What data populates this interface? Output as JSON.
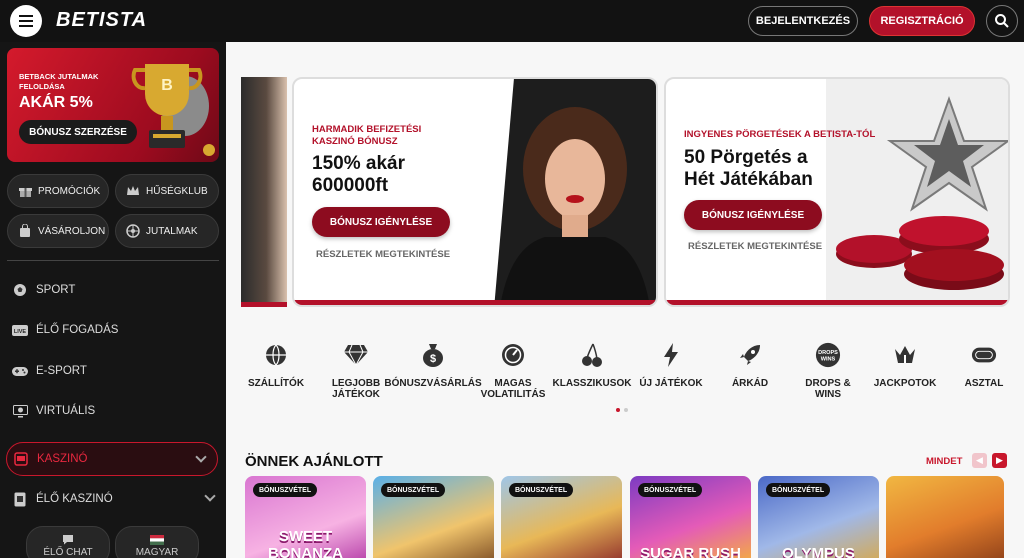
{
  "header": {
    "logo": "BETISTA",
    "login_label": "BEJELENTKEZÉS",
    "register_label": "REGISZTRÁCIÓ"
  },
  "sidebar": {
    "promo": {
      "small_text": "BETBACK JUTALMAK FELOLDÁSA",
      "big_text": "AKÁR 5%",
      "cta": "BÓNUSZ SZERZÉSE"
    },
    "quick_buttons": [
      {
        "label": "PROMÓCIÓK",
        "icon": "gift-icon"
      },
      {
        "label": "HŰSÉGKLUB",
        "icon": "crown-icon"
      },
      {
        "label": "VÁSÁROLJON",
        "icon": "bag-icon"
      },
      {
        "label": "JUTALMAK",
        "icon": "wheel-icon"
      }
    ],
    "nav": [
      {
        "label": "SPORT",
        "icon": "soccer-ball-icon"
      },
      {
        "label": "ÉLŐ FOGADÁS",
        "icon": "live-icon"
      },
      {
        "label": "E-SPORT",
        "icon": "gamepad-icon"
      },
      {
        "label": "VIRTUÁLIS",
        "icon": "virtual-icon"
      },
      {
        "label": "KASZINÓ",
        "icon": "slot-icon"
      },
      {
        "label": "ÉLŐ KASZINÓ",
        "icon": "cards-icon"
      }
    ],
    "bottom": {
      "chat_label": "ÉLŐ CHAT",
      "language_label": "MAGYAR"
    }
  },
  "banners": [
    {
      "pre": "HARMADIK BEFIZETÉSI KASZINÓ BÓNUSZ",
      "title_line1": "150% akár",
      "title_line2": "600000ft",
      "cta": "BÓNUSZ IGÉNYLÉSE",
      "link": "RÉSZLETEK MEGTEKINTÉSE"
    },
    {
      "pre": "INGYENES PÖRGETÉSEK A BETISTA-TÓL",
      "title_line1": "50 Pörgetés a",
      "title_line2": "Hét Játékában",
      "cta": "BÓNUSZ IGÉNYLÉSE",
      "link": "RÉSZLETEK MEGTEKINTÉSE"
    }
  ],
  "categories": [
    {
      "label": "SZÁLLÍTÓK",
      "icon": "globe-icon"
    },
    {
      "label": "LEGJOBB JÁTÉKOK",
      "icon": "diamond-icon"
    },
    {
      "label": "BÓNUSZVÁSÁRLÁS",
      "icon": "money-bag-icon"
    },
    {
      "label": "MAGAS VOLATILITÁS",
      "icon": "gauge-icon"
    },
    {
      "label": "KLASSZIKUSOK",
      "icon": "cherry-icon"
    },
    {
      "label": "ÚJ JÁTÉKOK",
      "icon": "lightning-icon"
    },
    {
      "label": "ÁRKÁD",
      "icon": "rocket-icon"
    },
    {
      "label": "DROPS & WINS",
      "icon": "drops-wins-icon"
    },
    {
      "label": "JACKPOTOK",
      "icon": "jackpot-icon"
    },
    {
      "label": "ASZTAL",
      "icon": "table-icon"
    }
  ],
  "recommended": {
    "title": "ÖNNEK AJÁNLOTT",
    "all_label": "MINDET",
    "games": [
      {
        "tag": "BÓNUSZVÉTEL",
        "title": "SWEET BONANZA"
      },
      {
        "tag": "BÓNUSZVÉTEL",
        "title": ""
      },
      {
        "tag": "BÓNUSZVÉTEL",
        "title": ""
      },
      {
        "tag": "BÓNUSZVÉTEL",
        "title": "SUGAR RUSH"
      },
      {
        "tag": "BÓNUSZVÉTEL",
        "title": "OLYMPUS"
      },
      {
        "tag": "",
        "title": ""
      }
    ]
  },
  "colors": {
    "brand_red": "#b3112a",
    "sidebar_bg": "#151515"
  }
}
